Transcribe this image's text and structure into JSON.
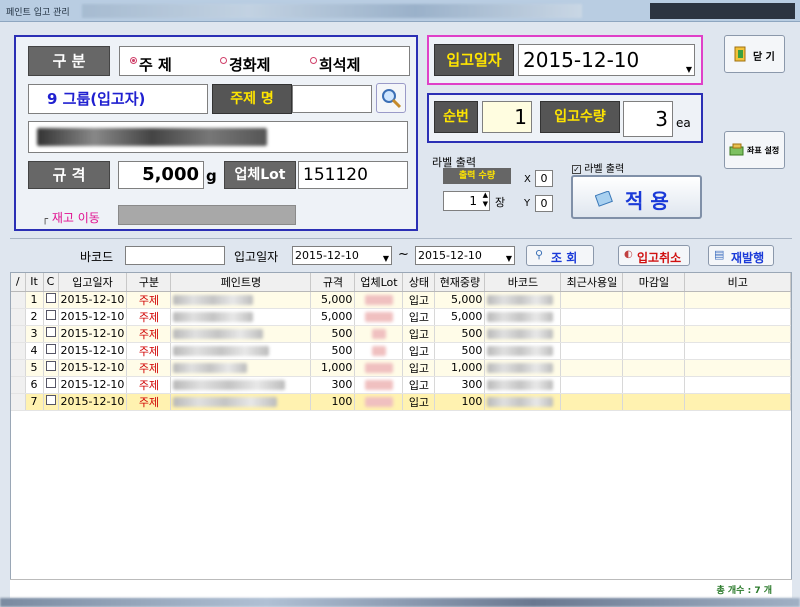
{
  "window": {
    "title": "페인트 입고 관리"
  },
  "form": {
    "category_label": "구 분",
    "radios": [
      {
        "label": "주  제",
        "selected": true
      },
      {
        "label": "경화제",
        "selected": false
      },
      {
        "label": "희석제",
        "selected": false
      }
    ],
    "group_label": "9 그룹(입고자)",
    "main_name_label": "주제 명",
    "main_name_value": "",
    "spec_label": "규 격",
    "spec_value": "5,000",
    "spec_unit": "g",
    "lot_label": "업체Lot",
    "lot_value": "151120",
    "stock_move_label": "재고 이동",
    "date_label": "입고일자",
    "date_value": "2015-12-10",
    "seq_label": "순번",
    "seq_value": "1",
    "qty_label": "입고수량",
    "qty_value": "3",
    "qty_unit": "ea",
    "label_output_title": "라벨 출력",
    "output_qty_label": "출력 수량",
    "output_qty_value": "1",
    "output_qty_unit": "장",
    "x_label": "X",
    "x_value": "0",
    "y_label": "Y",
    "y_value": "0",
    "label_output_check": "라벨 출력",
    "apply_label": "적 용"
  },
  "buttons": {
    "close": "닫 기",
    "coord_settings": "좌표 설정",
    "search": "조 회",
    "cancel_receipt": "입고취소",
    "reissue": "재발행"
  },
  "filter": {
    "barcode_label": "바코드",
    "barcode_value": "",
    "date_label": "입고일자",
    "date_from": "2015-12-10",
    "tilde": "~",
    "date_to": "2015-12-10"
  },
  "grid": {
    "headers": [
      "/",
      "It",
      "C",
      "입고일자",
      "구분",
      "페인트명",
      "규격",
      "업체Lot",
      "상태",
      "현재중량",
      "바코드",
      "최근사용일",
      "마감일",
      "비고"
    ],
    "rows": [
      {
        "no": "1",
        "date": "2015-12-10",
        "type": "주제",
        "spec": "5,000",
        "status": "입고",
        "weight": "5,000"
      },
      {
        "no": "2",
        "date": "2015-12-10",
        "type": "주제",
        "spec": "5,000",
        "status": "입고",
        "weight": "5,000"
      },
      {
        "no": "3",
        "date": "2015-12-10",
        "type": "주제",
        "spec": "500",
        "status": "입고",
        "weight": "500"
      },
      {
        "no": "4",
        "date": "2015-12-10",
        "type": "주제",
        "spec": "500",
        "status": "입고",
        "weight": "500"
      },
      {
        "no": "5",
        "date": "2015-12-10",
        "type": "주제",
        "spec": "1,000",
        "status": "입고",
        "weight": "1,000"
      },
      {
        "no": "6",
        "date": "2015-12-10",
        "type": "주제",
        "spec": "300",
        "status": "입고",
        "weight": "300"
      },
      {
        "no": "7",
        "date": "2015-12-10",
        "type": "주제",
        "spec": "100",
        "status": "입고",
        "weight": "100"
      }
    ],
    "total_label": "총 개수 : 7 개"
  }
}
